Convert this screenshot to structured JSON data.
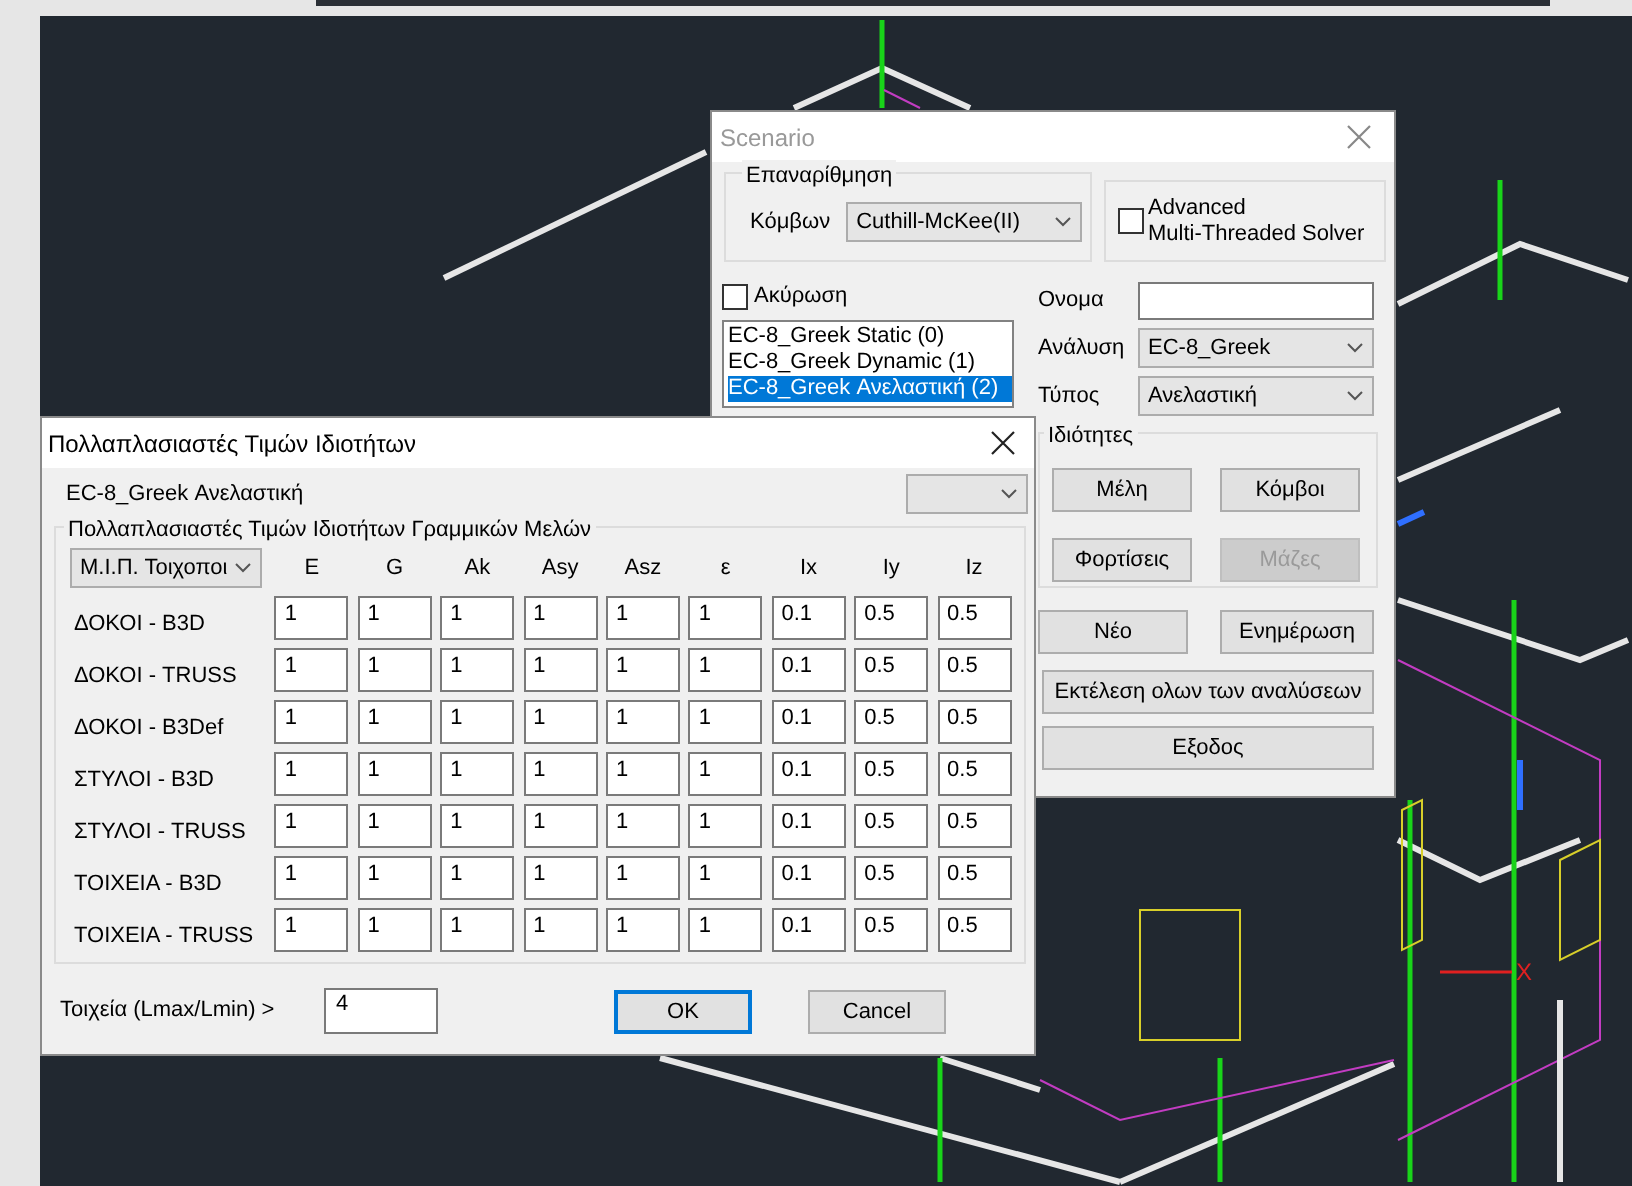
{
  "canvas": {
    "axis_label": "X"
  },
  "scenario_dialog": {
    "title": "Scenario",
    "active": false,
    "renumbering": {
      "title": "Επαναρίθμηση",
      "label": "Κόμβων",
      "value": "Cuthill-McKee(II)"
    },
    "advanced_solver": {
      "label": "Advanced\nMulti-Threaded Solver",
      "checked": false
    },
    "cancel_checkbox": {
      "label": "Ακύρωση",
      "checked": false
    },
    "scenarios": [
      {
        "label": "EC-8_Greek Static (0)",
        "selected": false
      },
      {
        "label": "EC-8_Greek Dynamic (1)",
        "selected": false
      },
      {
        "label": "EC-8_Greek Ανελαστική (2)",
        "selected": true
      }
    ],
    "name_field": {
      "label": "Ονομα"
    },
    "analysis": {
      "label": "Ανάλυση",
      "value": "EC-8_Greek"
    },
    "type": {
      "label": "Τύπος",
      "value": "Ανελαστική"
    },
    "properties": {
      "title": "Ιδιότητες",
      "buttons": [
        {
          "label": "Μέλη",
          "disabled": false
        },
        {
          "label": "Κόμβοι",
          "disabled": false
        },
        {
          "label": "Φορτίσεις",
          "disabled": false
        },
        {
          "label": "Μάζες",
          "disabled": true
        }
      ]
    },
    "new_button": "Νέο",
    "update_button": "Ενημέρωση",
    "run_all_button": "Εκτέλεση ολων των αναλύσεων",
    "exit_button": "Εξοδος"
  },
  "multipliers_dialog": {
    "title": "Πολλαπλασιαστές Τιμών Ιδιοτήτων",
    "scenario_label": "EC-8_Greek Ανελαστική",
    "group_title": "Πολλαπλασιαστές Τιμών Ιδιοτήτων Γραμμικών Μελών",
    "material_select": "Μ.Ι.Π. Τοιχοποι",
    "columns": [
      "E",
      "G",
      "Ak",
      "Asy",
      "Asz",
      "ε",
      "Ix",
      "Iy",
      "Iz"
    ],
    "rows": [
      {
        "label": "ΔΟΚΟΙ - B3D",
        "values": [
          "1",
          "1",
          "1",
          "1",
          "1",
          "1",
          "0.1",
          "0.5",
          "0.5"
        ]
      },
      {
        "label": "ΔΟΚΟΙ - TRUSS",
        "values": [
          "1",
          "1",
          "1",
          "1",
          "1",
          "1",
          "0.1",
          "0.5",
          "0.5"
        ]
      },
      {
        "label": "ΔΟΚΟΙ - B3Def",
        "values": [
          "1",
          "1",
          "1",
          "1",
          "1",
          "1",
          "0.1",
          "0.5",
          "0.5"
        ]
      },
      {
        "label": "ΣΤΥΛΟΙ - B3D",
        "values": [
          "1",
          "1",
          "1",
          "1",
          "1",
          "1",
          "0.1",
          "0.5",
          "0.5"
        ]
      },
      {
        "label": "ΣΤΥΛΟΙ - TRUSS",
        "values": [
          "1",
          "1",
          "1",
          "1",
          "1",
          "1",
          "0.1",
          "0.5",
          "0.5"
        ]
      },
      {
        "label": "ΤΟΙΧΕΙΑ - B3D",
        "values": [
          "1",
          "1",
          "1",
          "1",
          "1",
          "1",
          "0.1",
          "0.5",
          "0.5"
        ]
      },
      {
        "label": "ΤΟΙΧΕΙΑ - TRUSS",
        "values": [
          "1",
          "1",
          "1",
          "1",
          "1",
          "1",
          "0.1",
          "0.5",
          "0.5"
        ]
      }
    ],
    "ratio_label": "Τοιχεία (Lmax/Lmin) >",
    "ratio_value": "4",
    "ok_button": "OK",
    "cancel_button": "Cancel"
  }
}
